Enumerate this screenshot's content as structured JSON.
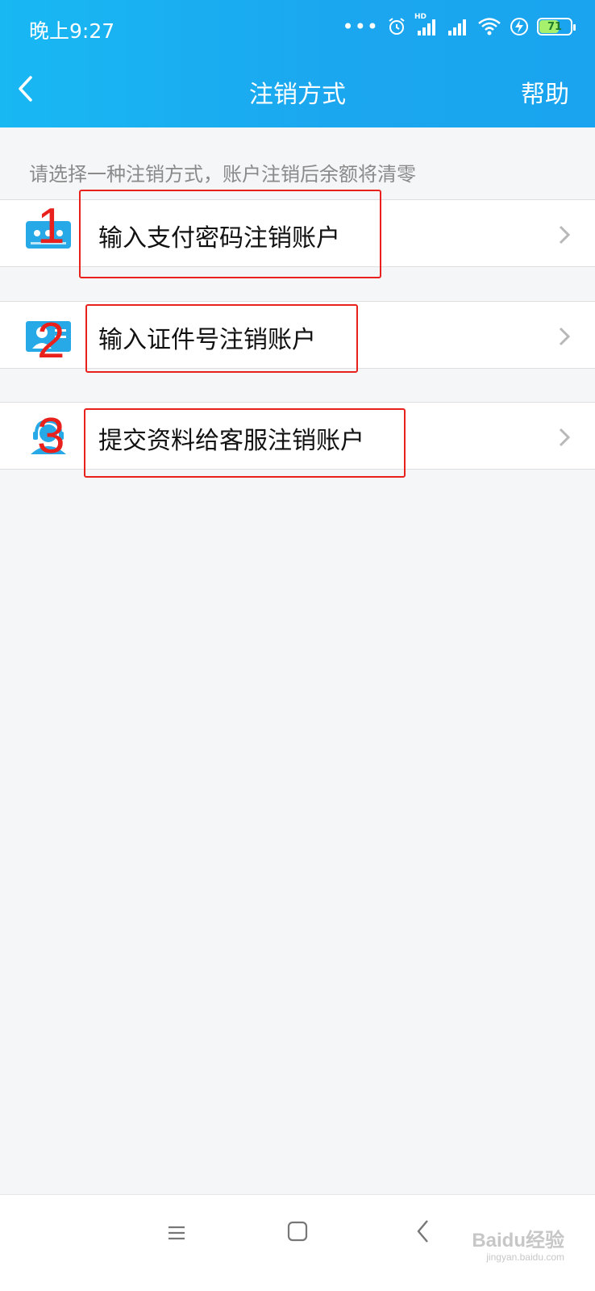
{
  "status_bar": {
    "time": "晚上9:27",
    "battery": "71",
    "network_label": "HD"
  },
  "header": {
    "title": "注销方式",
    "help": "帮助"
  },
  "hint": "请选择一种注销方式，账户注销后余额将清零",
  "options": [
    {
      "label": "输入支付密码注销账户",
      "icon": "password-icon",
      "annotation": "1"
    },
    {
      "label": "输入证件号注销账户",
      "icon": "id-card-icon",
      "annotation": "2"
    },
    {
      "label": "提交资料给客服注销账户",
      "icon": "customer-service-icon",
      "annotation": "3"
    }
  ],
  "watermark": {
    "brand": "Baidu经验",
    "url": "jingyan.baidu.com"
  },
  "colors": {
    "header_bg": "#1aa8ef",
    "annotation": "#e8211c",
    "icon": "#27a9e8"
  }
}
